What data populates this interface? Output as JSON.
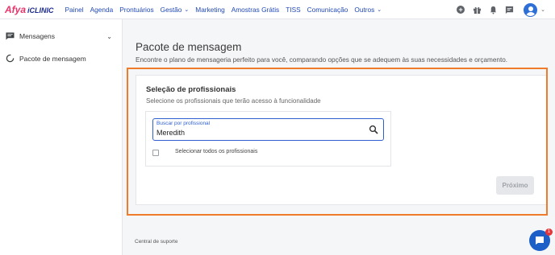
{
  "brand": {
    "afya": "Afya",
    "iclinic": "iCLINIC"
  },
  "nav": {
    "items": [
      {
        "label": "Painel"
      },
      {
        "label": "Agenda"
      },
      {
        "label": "Prontuários"
      },
      {
        "label": "Gestão"
      },
      {
        "label": "Marketing"
      },
      {
        "label": "Amostras Grátis"
      },
      {
        "label": "TISS"
      },
      {
        "label": "Comunicação"
      },
      {
        "label": "Outros"
      }
    ],
    "icons": [
      "add-circle-icon",
      "gift-icon",
      "bell-icon",
      "message-icon",
      "avatar-icon"
    ]
  },
  "sidebar": {
    "items": [
      {
        "label": "Mensagens",
        "icon": "message-icon"
      },
      {
        "label": "Pacote de mensagem",
        "icon": "loading-circle-icon"
      }
    ],
    "support": "Central de suporte"
  },
  "main": {
    "title": "Pacote de mensagem",
    "subtitle": "Encontre o plano de mensageria perfeito para você, comparando opções que se adequem às suas necessidades e orçamento.",
    "section": {
      "title": "Seleção de profissionais",
      "subtitle": "Selecione os profissionais que terão acesso à funcionalidade",
      "search": {
        "label": "Buscar por profissional",
        "value": "Meredith"
      },
      "select_all": "Selecionar todos os profissionais"
    },
    "next_button": "Próximo"
  },
  "chat": {
    "badge": "1"
  },
  "colors": {
    "brand_pink": "#e8336a",
    "brand_blue": "#1d2b8f",
    "link": "#2149b8",
    "highlight": "#f07b2a",
    "chat": "#1d5ec7"
  }
}
